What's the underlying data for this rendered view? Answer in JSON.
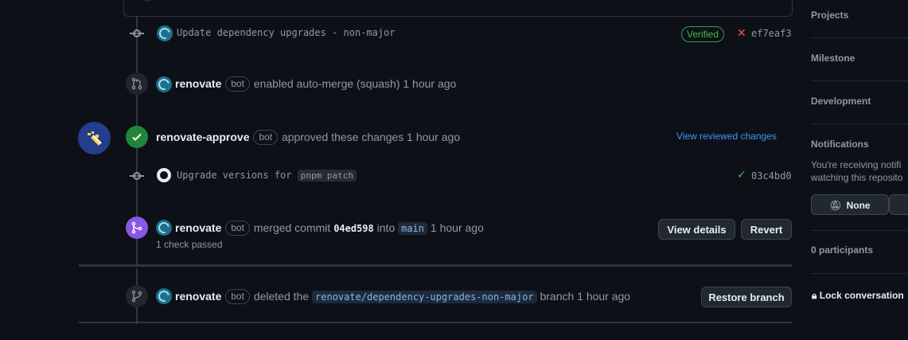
{
  "timeline": {
    "commit1": {
      "message": "Update dependency upgrades - non-major",
      "verified": "Verified",
      "status_icon": "x-icon",
      "sha": "ef7eaf3"
    },
    "automerge": {
      "user": "renovate",
      "bot": "bot",
      "text": "enabled auto-merge (squash) 1 hour ago"
    },
    "review": {
      "user": "renovate-approve",
      "bot": "bot",
      "text": "approved these changes 1 hour ago",
      "link": "View reviewed changes"
    },
    "commit2": {
      "message": "Upgrade versions for",
      "tag": "pnpm patch",
      "status_icon": "check-icon",
      "sha": "03c4bd0"
    },
    "merged": {
      "user": "renovate",
      "bot": "bot",
      "text1": "merged commit",
      "commit": "04ed598",
      "text2": "into",
      "branch": "main",
      "time": "1 hour ago",
      "checks": "1 check passed",
      "details_button": "View details",
      "revert_button": "Revert"
    },
    "deleted": {
      "user": "renovate",
      "bot": "bot",
      "text1": "deleted the",
      "branch": "renovate/dependency-upgrades-non-major",
      "text2": "branch 1 hour ago",
      "restore_button": "Restore branch"
    }
  },
  "sidebar": {
    "projects": "Projects",
    "milestone": "Milestone",
    "development": "Development",
    "notifications": "Notifications",
    "notif_text1": "You're receiving notifi",
    "notif_text2": "watching this reposito",
    "none_button": "None",
    "participants": "0 participants",
    "lock": "Lock conversation"
  },
  "colors": {
    "accent": "#4493f8",
    "success": "#238636",
    "merged": "#8957e5",
    "danger": "#f85149"
  }
}
